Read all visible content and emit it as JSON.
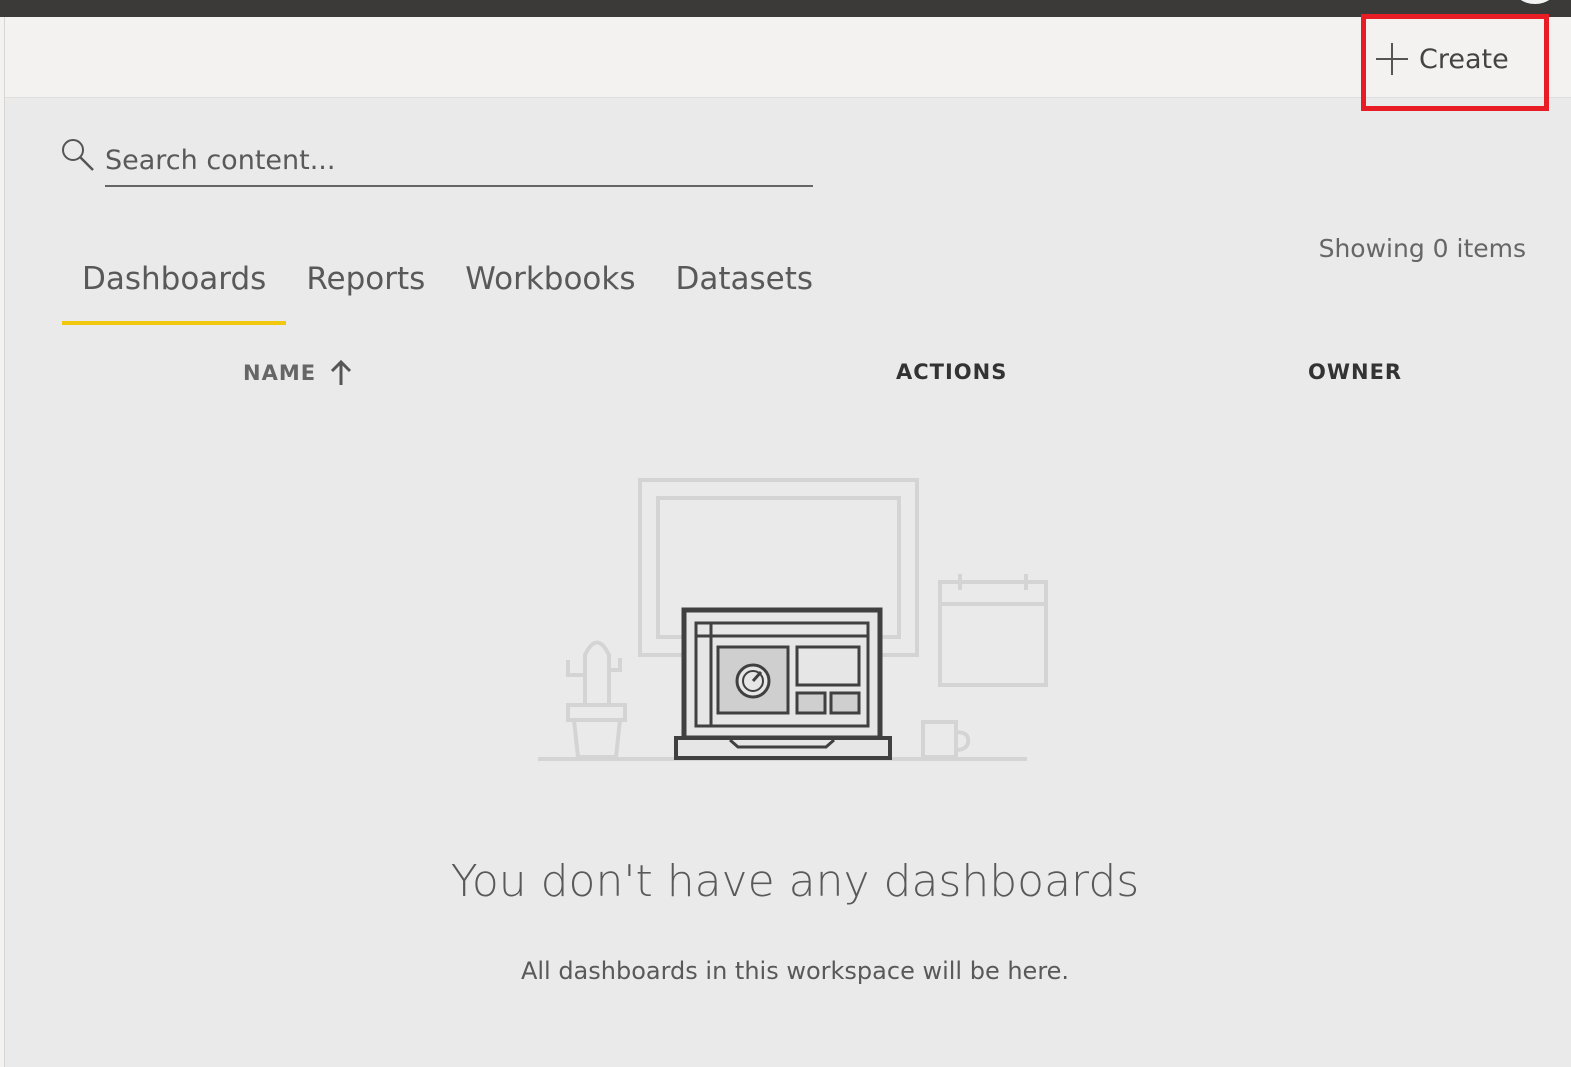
{
  "toolbar": {
    "create_label": "Create"
  },
  "search": {
    "placeholder": "Search content..."
  },
  "status": {
    "showing": "Showing 0 items"
  },
  "tabs": [
    {
      "label": "Dashboards",
      "active": true
    },
    {
      "label": "Reports"
    },
    {
      "label": "Workbooks"
    },
    {
      "label": "Datasets"
    }
  ],
  "columns": {
    "name": "NAME",
    "actions": "ACTIONS",
    "owner": "OWNER"
  },
  "empty_state": {
    "title": "You don't have any dashboards",
    "subtitle": "All dashboards in this workspace will be here."
  },
  "colors": {
    "accent": "#f2c80f",
    "highlight": "#e81c24",
    "topbar": "#3b3a39"
  },
  "icons": [
    "plus-icon",
    "search-icon",
    "sort-ascending-icon",
    "empty-dashboard-illustration"
  ]
}
